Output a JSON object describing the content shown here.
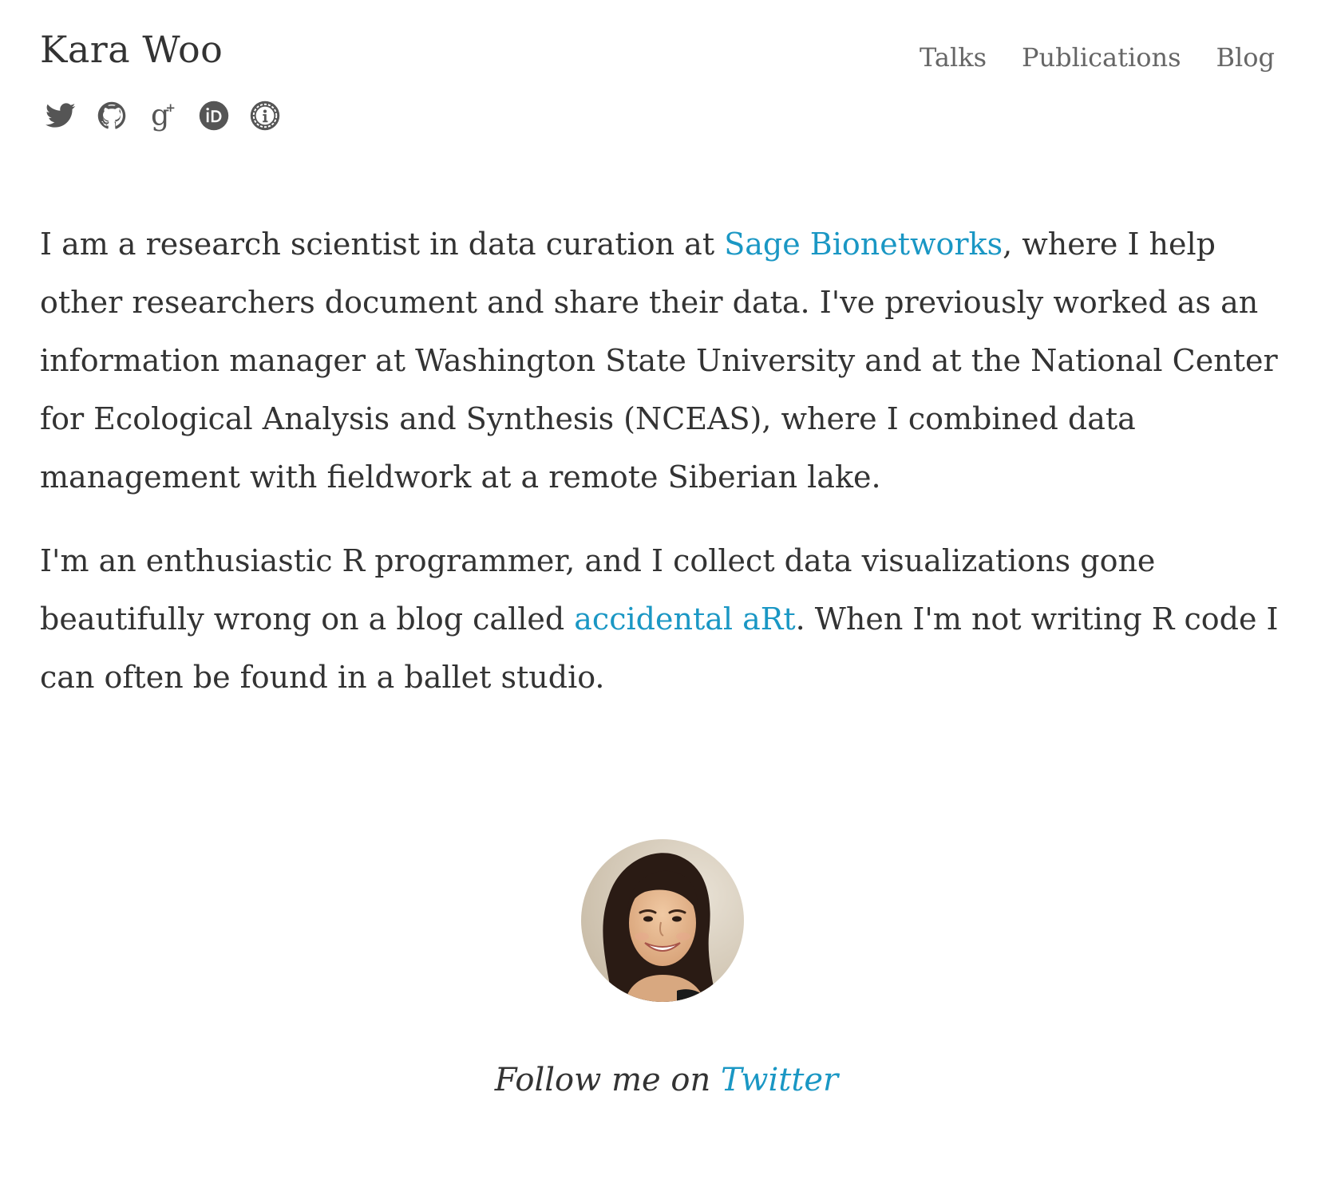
{
  "header": {
    "site_title": "Kara Woo",
    "nav": [
      {
        "label": "Talks"
      },
      {
        "label": "Publications"
      },
      {
        "label": "Blog"
      }
    ],
    "social_icons": [
      "twitter-icon",
      "github-icon",
      "google-scholar-icon",
      "orcid-icon",
      "impactstory-icon"
    ]
  },
  "bio": {
    "p1_before": "I am a research scientist in data curation at ",
    "p1_link": "Sage Bionetworks",
    "p1_after": ", where I help other researchers document and share their data. I've previously worked as an information manager at Washington State University and at the National Center for Ecological Analysis and Synthesis (NCEAS), where I combined data management with fieldwork at a remote Siberian lake.",
    "p2_before": "I'm an enthusiastic R programmer, and I collect data visualizations gone beautifully wrong on a blog called ",
    "p2_link": "accidental aRt",
    "p2_after": ". When I'm not writing R code I can often be found in a ballet studio."
  },
  "footer": {
    "follow_text": "Follow me on ",
    "follow_link": "Twitter"
  },
  "colors": {
    "link": "#1a97c4",
    "text": "#333333",
    "nav": "#666666",
    "icon": "#555555"
  }
}
